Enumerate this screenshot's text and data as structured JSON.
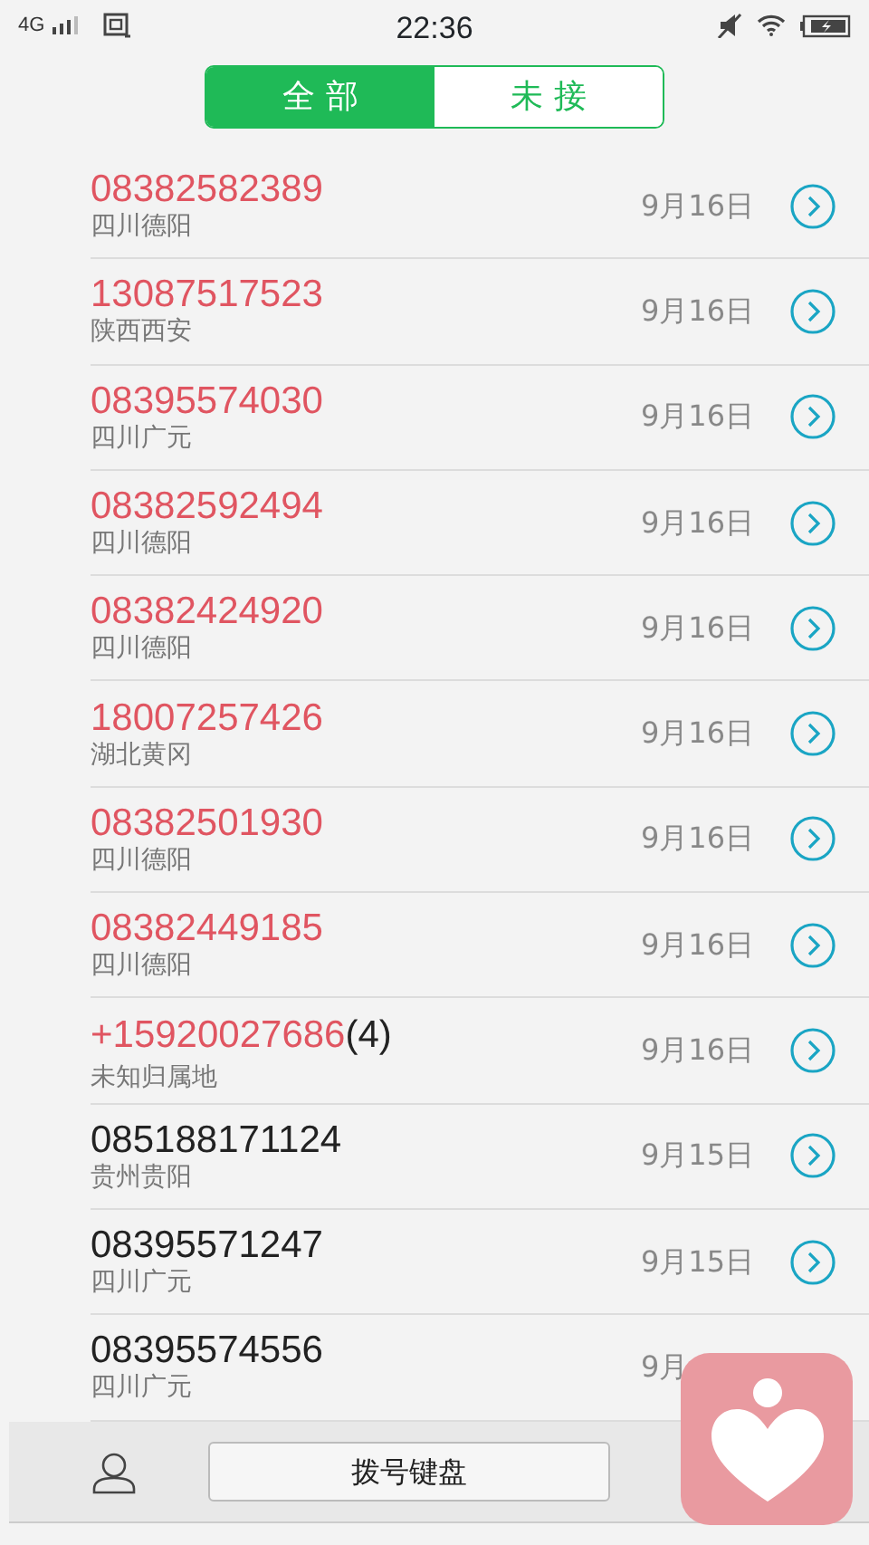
{
  "status_bar": {
    "network": "4G",
    "time": "22:36"
  },
  "tabs": [
    {
      "label": "全 部",
      "selected": true
    },
    {
      "label": "未 接",
      "selected": false
    }
  ],
  "calls": [
    {
      "number": "08382582389",
      "location": "四川德阳",
      "date": "9月16日",
      "missed": true,
      "detail_button": true
    },
    {
      "number": "13087517523",
      "location": "陕西西安",
      "date": "9月16日",
      "missed": true,
      "detail_button": true
    },
    {
      "number": "08395574030",
      "location": "四川广元",
      "date": "9月16日",
      "missed": true,
      "detail_button": true
    },
    {
      "number": "08382592494",
      "location": "四川德阳",
      "date": "9月16日",
      "missed": true,
      "detail_button": true
    },
    {
      "number": "08382424920",
      "location": "四川德阳",
      "date": "9月16日",
      "missed": true,
      "detail_button": true
    },
    {
      "number": "18007257426",
      "location": "湖北黄冈",
      "date": "9月16日",
      "missed": true,
      "detail_button": true
    },
    {
      "number": "08382501930",
      "location": "四川德阳",
      "date": "9月16日",
      "missed": true,
      "detail_button": true
    },
    {
      "number": "08382449185",
      "location": "四川德阳",
      "date": "9月16日",
      "missed": true,
      "detail_button": true
    },
    {
      "number": "+15920027686",
      "count": "(4)",
      "location": "未知归属地",
      "date": "9月16日",
      "missed": true,
      "detail_button": true
    },
    {
      "number": "085188171124",
      "location": "贵州贵阳",
      "date": "9月15日",
      "missed": false,
      "detail_button": true
    },
    {
      "number": "08395571247",
      "location": "四川广元",
      "date": "9月15日",
      "missed": false,
      "detail_button": true
    },
    {
      "number": "08395574556",
      "location": "四川广元",
      "date": "9月",
      "missed": false,
      "detail_button": false
    }
  ],
  "bottom_bar": {
    "dialpad_button": "拨号键盘"
  }
}
